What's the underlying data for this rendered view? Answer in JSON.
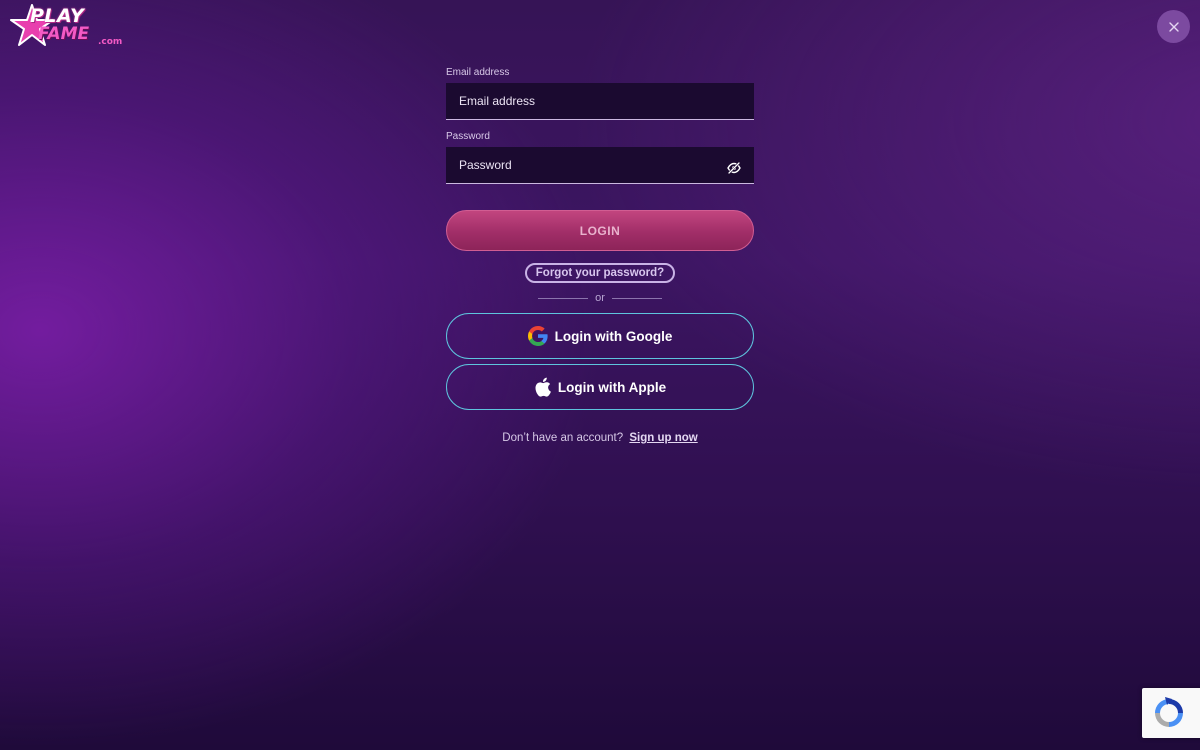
{
  "brand": {
    "logo_line1": "PLAY",
    "logo_line2": "FAME",
    "logo_suffix": ".com"
  },
  "close": {
    "icon": "close-icon"
  },
  "form": {
    "email": {
      "label": "Email address",
      "placeholder": "Email address",
      "value": ""
    },
    "password": {
      "label": "Password",
      "placeholder": "Password",
      "value": "",
      "toggle_icon": "eye-off-icon"
    },
    "login_label": "LOGIN",
    "forgot_label": "Forgot your password?",
    "divider_text": "or",
    "google_label": "Login with Google",
    "apple_label": "Login with Apple",
    "signup_prompt": "Don’t have an account?",
    "signup_link": "Sign up now"
  },
  "recaptcha": {
    "icon": "recaptcha-icon"
  },
  "colors": {
    "background": "#3c1562",
    "login_button": "#a12e68",
    "social_border": "#5ec4dd",
    "logo_pink": "#f45ac5"
  }
}
